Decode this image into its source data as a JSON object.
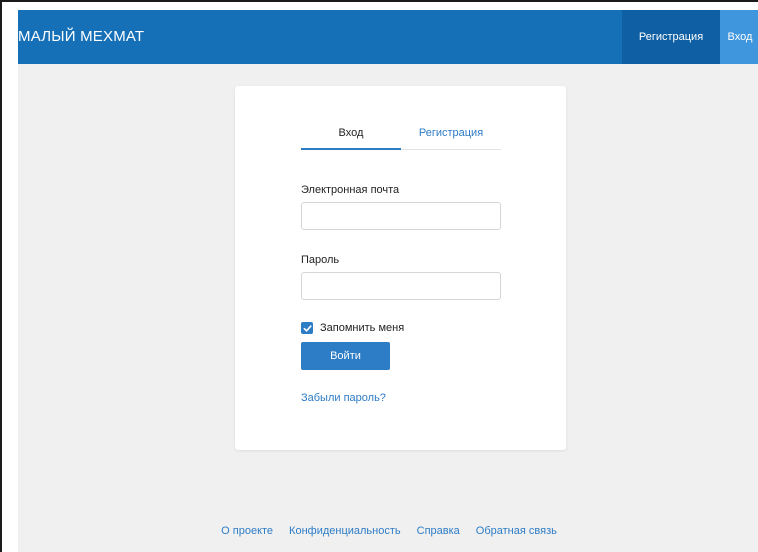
{
  "header": {
    "brand": "МАЛЫЙ МЕХМАТ",
    "nav_register": "Регистрация",
    "nav_login": "Вход"
  },
  "login_card": {
    "tabs": [
      {
        "label": "Вход",
        "active": true
      },
      {
        "label": "Регистрация",
        "active": false
      }
    ],
    "email_label": "Электронная почта",
    "email_value": "",
    "password_label": "Пароль",
    "password_value": "",
    "remember_label": "Запомнить меня",
    "remember_checked": true,
    "submit_label": "Войти",
    "forgot_link": "Забыли пароль?"
  },
  "footer": {
    "links": [
      "О проекте",
      "Конфиденциальность",
      "Справка",
      "Обратная связь"
    ]
  },
  "colors": {
    "header_bg": "#1570b8",
    "nav_register_bg": "#0e5fa3",
    "nav_login_bg": "#3f96dd",
    "accent": "#2d7cc6",
    "page_bg": "#f0f0f0"
  },
  "icons": {
    "checkbox": "check-icon"
  }
}
